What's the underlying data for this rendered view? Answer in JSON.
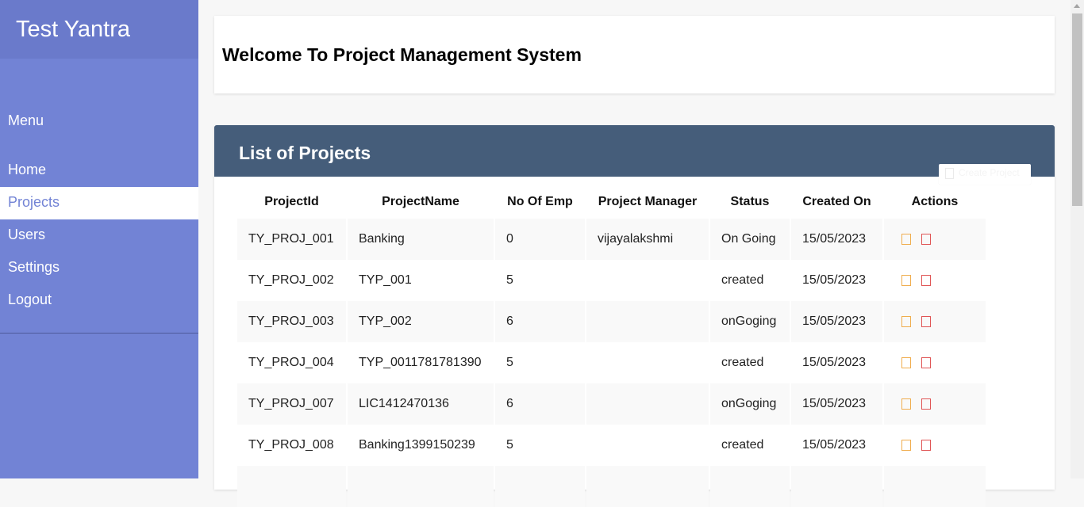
{
  "app": {
    "brand": "Test Yantra"
  },
  "sidebar": {
    "menu_label": "Menu",
    "items": [
      {
        "label": "Home",
        "active": false
      },
      {
        "label": "Projects",
        "active": true
      },
      {
        "label": "Users",
        "active": false
      },
      {
        "label": "Settings",
        "active": false
      },
      {
        "label": "Logout",
        "active": false
      }
    ]
  },
  "welcome": {
    "title": "Welcome To Project Management System"
  },
  "projects": {
    "title": "List of Projects",
    "create_label": "Create Project",
    "columns": [
      "ProjectId",
      "ProjectName",
      "No Of Emp",
      "Project Manager",
      "Status",
      "Created On",
      "Actions"
    ],
    "rows": [
      {
        "id": "TY_PROJ_001",
        "name": "Banking",
        "emp": "0",
        "manager": "vijayalakshmi",
        "status": "On Going",
        "created": "15/05/2023"
      },
      {
        "id": "TY_PROJ_002",
        "name": "TYP_001",
        "emp": "5",
        "manager": "",
        "status": "created",
        "created": "15/05/2023"
      },
      {
        "id": "TY_PROJ_003",
        "name": "TYP_002",
        "emp": "6",
        "manager": "",
        "status": "onGoging",
        "created": "15/05/2023"
      },
      {
        "id": "TY_PROJ_004",
        "name": "TYP_0011781781390",
        "emp": "5",
        "manager": "",
        "status": "created",
        "created": "15/05/2023"
      },
      {
        "id": "TY_PROJ_007",
        "name": "LIC1412470136",
        "emp": "6",
        "manager": "",
        "status": "onGoging",
        "created": "15/05/2023"
      },
      {
        "id": "TY_PROJ_008",
        "name": "Banking1399150239",
        "emp": "5",
        "manager": "",
        "status": "created",
        "created": "15/05/2023"
      }
    ]
  },
  "colors": {
    "sidebar": "#7283d5",
    "brand_bar": "#6a7acb",
    "panel_header": "#455d7a",
    "edit_icon": "#f0ad4e",
    "delete_icon": "#e05555"
  },
  "icons": {
    "edit": "edit-icon",
    "delete": "delete-icon",
    "create": "plus-icon"
  }
}
